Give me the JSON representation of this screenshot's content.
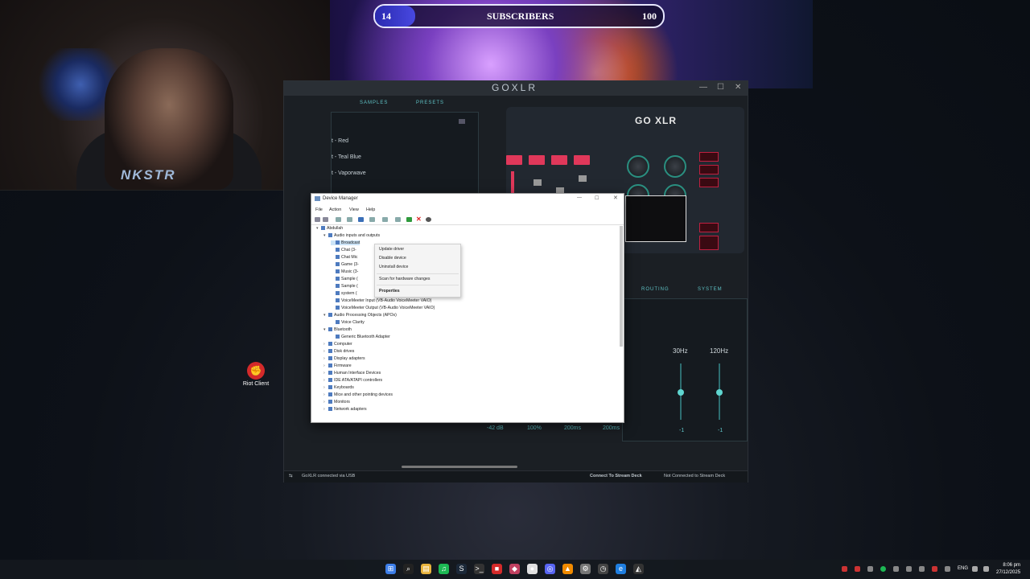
{
  "subscribers": {
    "label": "SUBSCRIBERS",
    "current": "14",
    "goal": "100",
    "progress": 0.14
  },
  "webcam": {
    "overlay_text": "NKSTR"
  },
  "desktop_icons": [
    {
      "label": "Riot Client",
      "icon": "riot-fist-icon"
    }
  ],
  "goxlr": {
    "title": "GOXLR",
    "device_logo": "GO XLR",
    "tabs": [
      "SAMPLES",
      "PRESETS"
    ],
    "presets": [
      "t - Red",
      "t - Teal Blue",
      "t - Vaporwave"
    ],
    "bottom_tabs": [
      "ROUTING",
      "SYSTEM"
    ],
    "eq": {
      "band1": "30Hz",
      "band2": "120Hz",
      "band1_val": "-1",
      "band2_val": "-1"
    },
    "values": [
      "-42 dB",
      "100%",
      "200ms",
      "200ms"
    ],
    "status_left": "GoXLR connected via USB",
    "status_mid": "Connect To Stream Deck",
    "status_right": "Not Connected to Stream Deck",
    "accent": "#5fc3c6",
    "fader_color": "#e0385a"
  },
  "device_manager": {
    "title": "Device Manager",
    "menu": [
      "File",
      "Action",
      "View",
      "Help"
    ],
    "tree": [
      {
        "label": "Abdullah",
        "level": 0,
        "expanded": true
      },
      {
        "label": "Audio inputs and outputs",
        "level": 1,
        "expanded": true
      },
      {
        "label": "Broadcast",
        "level": 2,
        "selected": true
      },
      {
        "label": "Chat (3-",
        "level": 2
      },
      {
        "label": "Chat Mic",
        "level": 2
      },
      {
        "label": "Game (3-",
        "level": 2
      },
      {
        "label": "Music (3-",
        "level": 2
      },
      {
        "label": "Sample (",
        "level": 2
      },
      {
        "label": "Sample (",
        "level": 2
      },
      {
        "label": "system (",
        "level": 2
      },
      {
        "label": "VoiceMeeter Input (VB-Audio VoiceMeeter VAIO)",
        "level": 2
      },
      {
        "label": "VoiceMeeter Output (VB-Audio VoiceMeeter VAIO)",
        "level": 2
      },
      {
        "label": "Audio Processing Objects (APOs)",
        "level": 1,
        "expanded": true
      },
      {
        "label": "Voice Clarity",
        "level": 2
      },
      {
        "label": "Bluetooth",
        "level": 1,
        "expanded": true
      },
      {
        "label": "Generic Bluetooth Adapter",
        "level": 2
      },
      {
        "label": "Computer",
        "level": 1
      },
      {
        "label": "Disk drives",
        "level": 1
      },
      {
        "label": "Display adapters",
        "level": 1
      },
      {
        "label": "Firmware",
        "level": 1
      },
      {
        "label": "Human Interface Devices",
        "level": 1
      },
      {
        "label": "IDE ATA/ATAPI controllers",
        "level": 1
      },
      {
        "label": "Keyboards",
        "level": 1
      },
      {
        "label": "Mice and other pointing devices",
        "level": 1
      },
      {
        "label": "Monitors",
        "level": 1
      },
      {
        "label": "Network adapters",
        "level": 1
      }
    ],
    "context_menu": [
      "Update driver",
      "Disable device",
      "Uninstall device",
      "Scan for hardware changes",
      "Properties"
    ]
  },
  "taskbar": {
    "apps": [
      "windows-start-icon",
      "search-icon",
      "file-explorer-icon",
      "spotify-icon",
      "steam-icon",
      "terminal-icon",
      "app-red-icon",
      "game-icon",
      "chrome-icon",
      "discord-icon",
      "vlc-icon",
      "settings-icon",
      "clock-app-icon",
      "edge-icon",
      "goxlr-app-icon"
    ],
    "lang": "ENG",
    "time": "8:06 pm",
    "date": "27/12/2025"
  }
}
